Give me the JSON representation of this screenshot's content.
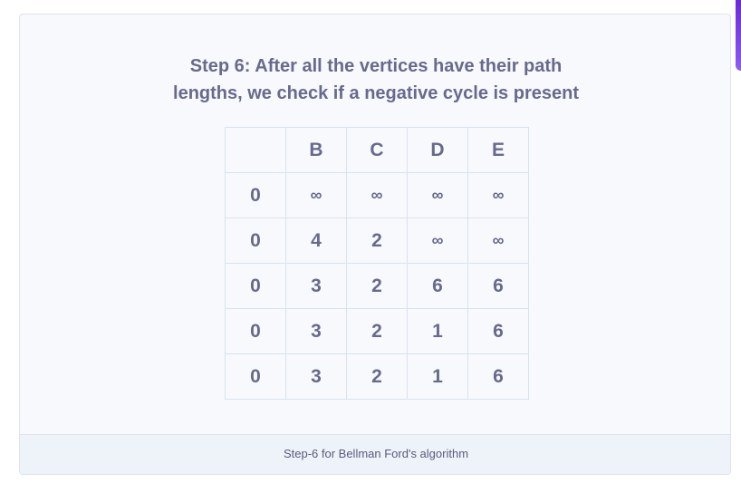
{
  "figure": {
    "title_line1": "Step 6: After all the vertices have their path",
    "title_line2": "lengths, we check if a negative cycle is present",
    "caption": "Step-6 for Bellman Ford's algorithm"
  },
  "table": {
    "headers": [
      "",
      "B",
      "C",
      "D",
      "E"
    ],
    "rows": [
      [
        "0",
        "∞",
        "∞",
        "∞",
        "∞"
      ],
      [
        "0",
        "4",
        "2",
        "∞",
        "∞"
      ],
      [
        "0",
        "3",
        "2",
        "6",
        "6"
      ],
      [
        "0",
        "3",
        "2",
        "1",
        "6"
      ],
      [
        "0",
        "3",
        "2",
        "1",
        "6"
      ]
    ]
  },
  "colors": {
    "text": "#676a8c",
    "border": "#d6e4ee",
    "card_background": "#f8f9fc",
    "caption_background": "#eef3fa",
    "accent": "#6d28d9"
  }
}
